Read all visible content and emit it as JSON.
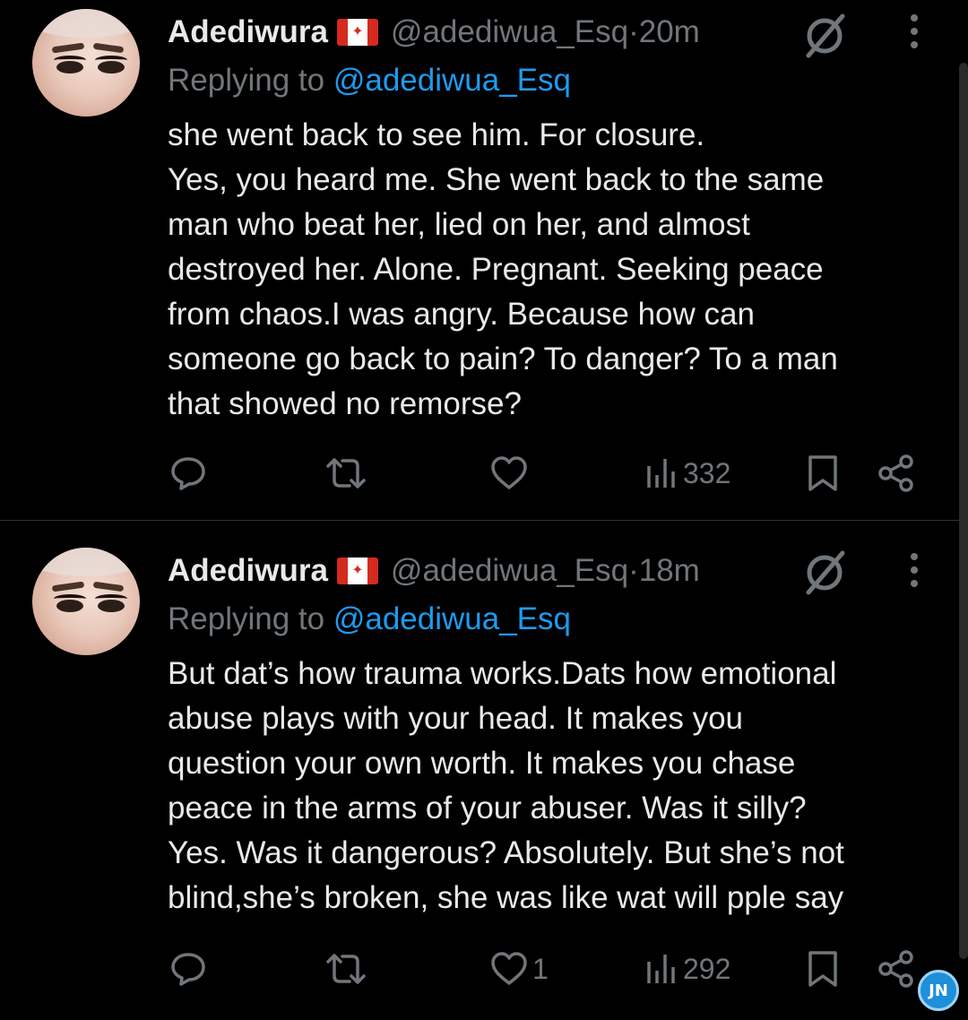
{
  "tweets": [
    {
      "name": "Adediwura",
      "flag": "🇨🇦",
      "handle": "@adediwua_Esq",
      "time": "20m",
      "replying_prefix": "Replying to",
      "replying_mention": "@adediwua_Esq",
      "lines": [
        "she went back to see him. For closure.",
        "Yes, you heard me. She went back to the same",
        "man who beat her, lied on her, and almost",
        "destroyed her. Alone. Pregnant. Seeking peace",
        "from chaos.I was angry. Because how can",
        "someone go back to pain? To danger? To a man",
        "that showed no remorse?"
      ],
      "likes": "",
      "views": "332"
    },
    {
      "name": "Adediwura",
      "flag": "🇨🇦",
      "handle": "@adediwua_Esq",
      "time": "18m",
      "replying_prefix": "Replying to",
      "replying_mention": "@adediwua_Esq",
      "lines": [
        "But dat’s how trauma works.Dats how emotional",
        "abuse plays with your head. It makes you",
        "question your own worth. It makes you chase",
        "peace in the arms of your abuser. Was it silly?",
        "Yes. Was it dangerous? Absolutely. But she’s not",
        "blind,she’s broken, she was like wat will pple say"
      ],
      "likes": "1",
      "views": "292"
    }
  ],
  "separator": " · ",
  "watermark": "JN",
  "icons": {
    "reply": "reply-icon",
    "retweet": "retweet-icon",
    "like": "heart-icon",
    "views": "views-icon",
    "bookmark": "bookmark-icon",
    "share": "share-icon",
    "grok": "grok-icon",
    "more": "more-icon"
  },
  "colors": {
    "background": "#000000",
    "text": "#e7e9ea",
    "muted": "#71767b",
    "link": "#1d9bf0",
    "divider": "#2f3336"
  }
}
